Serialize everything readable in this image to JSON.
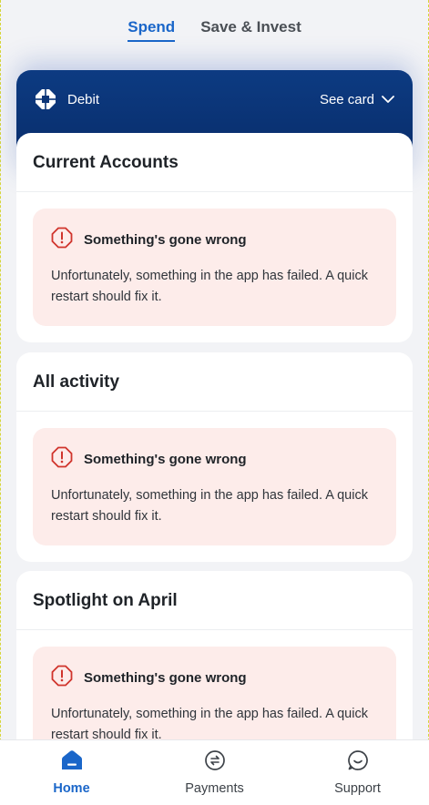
{
  "tabs": [
    {
      "label": "Spend",
      "active": true
    },
    {
      "label": "Save & Invest",
      "active": false
    }
  ],
  "card": {
    "label": "Debit",
    "see_card_label": "See card",
    "logo_icon": "bank-logo-icon",
    "color_top": "#0d3b82"
  },
  "sections": [
    {
      "title": "Current Accounts",
      "error_title": "Something's gone wrong",
      "error_body": "Unfortunately, something in the app has failed. A quick restart should fix it."
    },
    {
      "title": "All activity",
      "error_title": "Something's gone wrong",
      "error_body": "Unfortunately, something in the app has failed. A quick restart should fix it."
    },
    {
      "title": "Spotlight on April",
      "error_title": "Something's gone wrong",
      "error_body": "Unfortunately, something in the app has failed. A quick restart should fix it."
    }
  ],
  "nav": [
    {
      "label": "Home",
      "icon": "home-icon",
      "active": true
    },
    {
      "label": "Payments",
      "icon": "payments-icon",
      "active": false
    },
    {
      "label": "Support",
      "icon": "support-icon",
      "active": false
    }
  ],
  "colors": {
    "accent": "#1a66c9",
    "error_bg": "#fdecea",
    "error_icon": "#d0342c"
  }
}
